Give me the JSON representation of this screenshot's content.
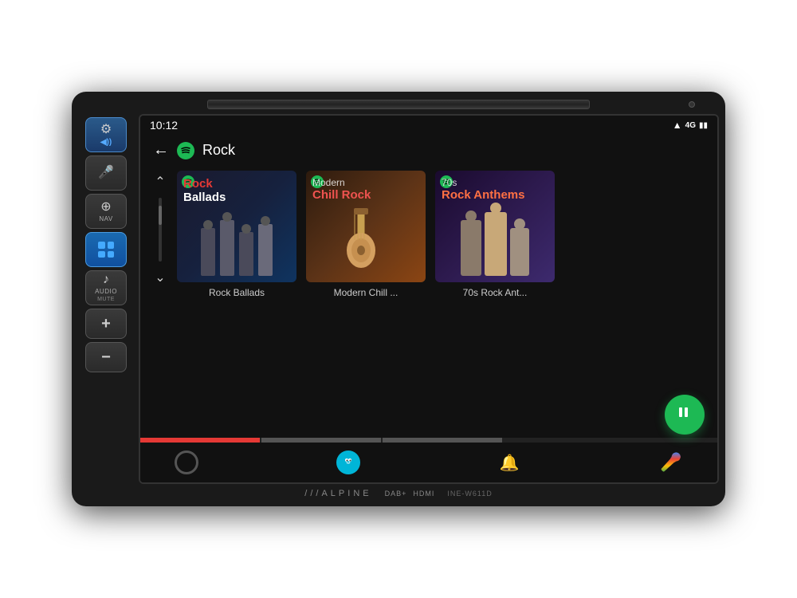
{
  "device": {
    "brand": "///ALPINE",
    "model": "INE-W611D",
    "specs": [
      "DAB+",
      "HDMI"
    ]
  },
  "status_bar": {
    "time": "10:12",
    "signal": "4G"
  },
  "header": {
    "back_label": "←",
    "spotify_label": "Spotify",
    "page_title": "Rock"
  },
  "playlists": [
    {
      "id": "rock-ballads",
      "name": "Rock Ballads",
      "display_name": "Rock Ballads",
      "art_title_top": "",
      "art_title_line1": "Rock",
      "art_title_line2": "Ballads"
    },
    {
      "id": "modern-chill-rock",
      "name": "Modern Chill Rock",
      "display_name": "Modern Chill ...",
      "art_title_top": "Modern",
      "art_title_line1": "Chill Rock",
      "art_title_line2": ""
    },
    {
      "id": "70s-rock-anthems",
      "name": "70s Rock Anthems",
      "display_name": "70s Rock Ant...",
      "art_title_top": "70s",
      "art_title_line1": "Rock",
      "art_title_line2": "Anthems"
    }
  ],
  "controls": {
    "settings_label": "",
    "mic_label": "",
    "nav_label": "NAV",
    "grid_label": "",
    "audio_label": "AUDIO",
    "mute_label": "MUTE",
    "volume_up": "+",
    "volume_down": "−"
  },
  "bottom_nav": {
    "home_label": "",
    "waze_label": "W",
    "notification_label": "🔔",
    "voice_label": "🎤"
  },
  "colors": {
    "accent_green": "#1db954",
    "accent_red": "#e53935",
    "background": "#111111",
    "text_primary": "#ffffff",
    "text_secondary": "#cccccc"
  }
}
